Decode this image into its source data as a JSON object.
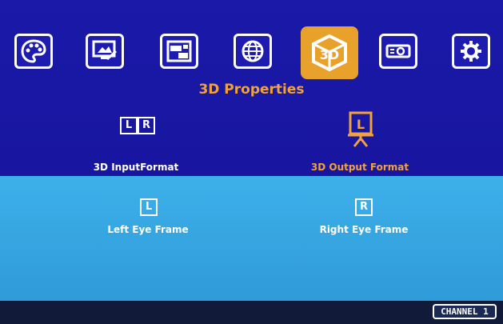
{
  "tabs": [
    {
      "name": "palette",
      "active": false
    },
    {
      "name": "picture-adjust",
      "active": false
    },
    {
      "name": "layout",
      "active": false
    },
    {
      "name": "network",
      "active": false
    },
    {
      "name": "3d",
      "active": true
    },
    {
      "name": "projector",
      "active": false
    },
    {
      "name": "settings",
      "active": false
    }
  ],
  "section_title": "3D Properties",
  "options": {
    "input_format": {
      "label": "3D InputFormat",
      "icon_left": "L",
      "icon_right": "R"
    },
    "output_format": {
      "label": "3D Output Format",
      "icon": "L"
    },
    "left_eye": {
      "label": "Left Eye Frame",
      "icon": "L"
    },
    "right_eye": {
      "label": "Right Eye Frame",
      "icon": "R"
    }
  },
  "tab_3d_label": "3D",
  "channel_label": "CHANNEL 1",
  "colors": {
    "accent": "#e8a12a",
    "upper_bg": "#1a19a8",
    "lower_bg": "#3db0ea"
  }
}
